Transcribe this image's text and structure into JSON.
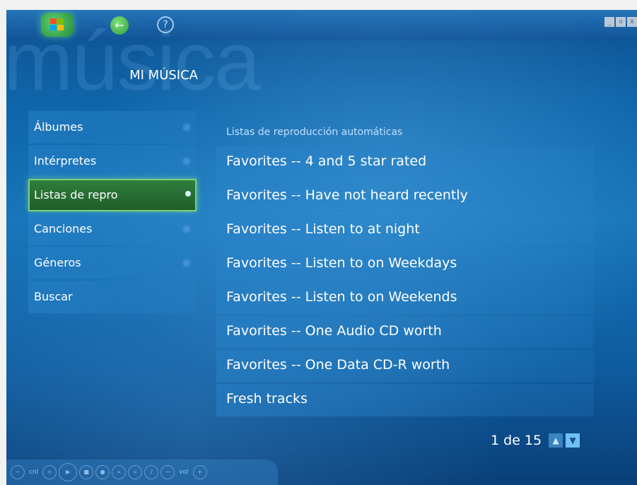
{
  "app": {
    "background_word": "música",
    "page_title": "MI MÚSICA"
  },
  "top_bar": {
    "icons": [
      "windows-start-icon",
      "back-arrow-icon",
      "help-icon"
    ]
  },
  "window_controls": [
    "_",
    "▫",
    "x"
  ],
  "sidebar": {
    "items": [
      {
        "label": "Álbumes"
      },
      {
        "label": "Intérpretes"
      },
      {
        "label": "Listas de repro"
      },
      {
        "label": "Canciones"
      },
      {
        "label": "Géneros"
      },
      {
        "label": "Buscar"
      }
    ],
    "selected_index": 2
  },
  "main": {
    "section_label": "Listas de reproducción automáticas",
    "items": [
      {
        "label": "Favorites -- 4 and 5 star rated"
      },
      {
        "label": "Favorites -- Have not heard recently"
      },
      {
        "label": "Favorites -- Listen to at night"
      },
      {
        "label": "Favorites -- Listen to on Weekdays"
      },
      {
        "label": "Favorites -- Listen to on Weekends"
      },
      {
        "label": "Favorites -- One Audio CD worth"
      },
      {
        "label": "Favorites -- One Data CD-R worth"
      },
      {
        "label": "Fresh tracks"
      }
    ]
  },
  "pager": {
    "text": "1 de 15",
    "up_icon": "chevron-up-icon",
    "down_icon": "chevron-down-icon"
  },
  "transport": {
    "channel_label": "cnl",
    "volume_label": "vol"
  },
  "colors": {
    "accent_green": "#2f7e3c",
    "highlight_green_border": "#7bd07a",
    "background_blue": "#1674b8"
  }
}
